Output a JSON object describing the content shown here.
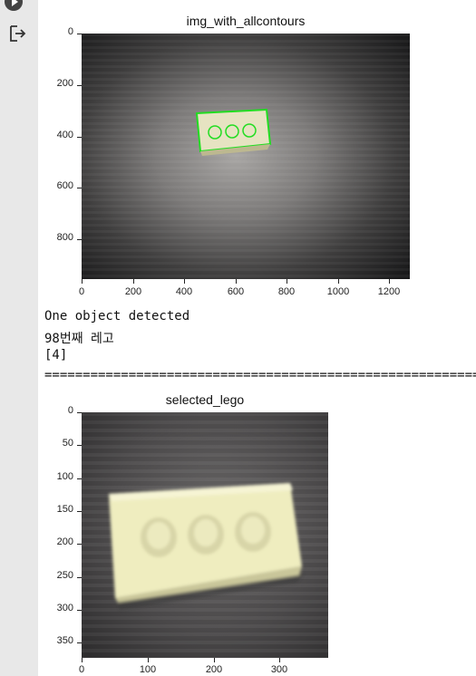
{
  "cell": {
    "run_button": "play-circle-icon",
    "output_icon": "output-arrow-icon"
  },
  "figure1": {
    "title": "img_with_allcontours",
    "yticks": [
      "0",
      "200",
      "400",
      "600",
      "800"
    ],
    "xticks": [
      "0",
      "200",
      "400",
      "600",
      "800",
      "1000",
      "1200"
    ],
    "contour_color": "#22dd22"
  },
  "stdout": {
    "line1": "One object detected",
    "line2": "98번째 레고",
    "line3": "[4]",
    "separator": "============================================================"
  },
  "figure2": {
    "title": "selected_lego",
    "yticks": [
      "0",
      "50",
      "100",
      "150",
      "200",
      "250",
      "300",
      "350"
    ],
    "xticks": [
      "0",
      "100",
      "200",
      "300"
    ]
  }
}
